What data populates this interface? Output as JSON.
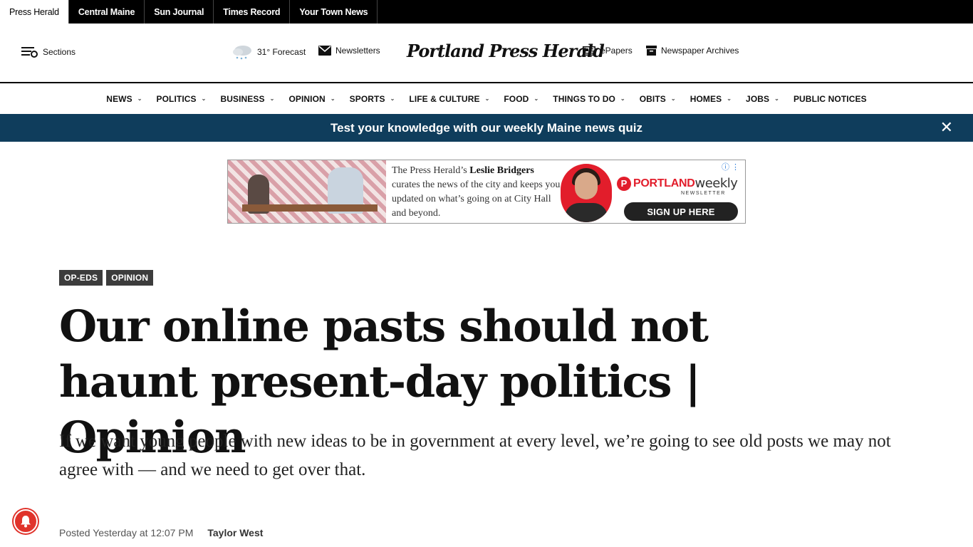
{
  "topbar": {
    "sites": [
      "Press Herald",
      "Central Maine",
      "Sun Journal",
      "Times Record",
      "Your Town News"
    ]
  },
  "header": {
    "sections_label": "Sections",
    "forecast_label": "31° Forecast",
    "newsletters_label": "Newsletters",
    "logo_text": "Portland Press Herald",
    "epapers_label": "ePapers",
    "archives_label": "Newspaper Archives"
  },
  "nav": {
    "items": [
      "NEWS",
      "POLITICS",
      "BUSINESS",
      "OPINION",
      "SPORTS",
      "LIFE & CULTURE",
      "FOOD",
      "THINGS TO DO",
      "OBITS",
      "HOMES",
      "JOBS",
      "PUBLIC NOTICES"
    ],
    "caret": "⌄"
  },
  "banner": {
    "text": "Test your knowledge with our weekly Maine news quiz",
    "close": "✕"
  },
  "ad": {
    "copy_prefix": "The Press Herald’s ",
    "copy_name": "Leslie Bridgers",
    "copy_rest": " curates the news of the city and keeps you updated on what’s going on at City Hall and beyond.",
    "brand_mark": "P",
    "brand_name": "PORTLAND",
    "brand_suffix": "weekly",
    "brand_sub": "NEWSLETTER",
    "cta": "SIGN UP HERE",
    "info": "ⓘ ⋮"
  },
  "article": {
    "tags": [
      "OP-EDS",
      "OPINION"
    ],
    "headline": "Our online pasts should not haunt present-day politics | Opinion",
    "dek": "If we want young people with new ideas to be in government at every level, we’re going to see old posts we may not agree with — and we need to get over that.",
    "posted": "Posted Yesterday at 12:07 PM",
    "author": "Taylor West"
  }
}
